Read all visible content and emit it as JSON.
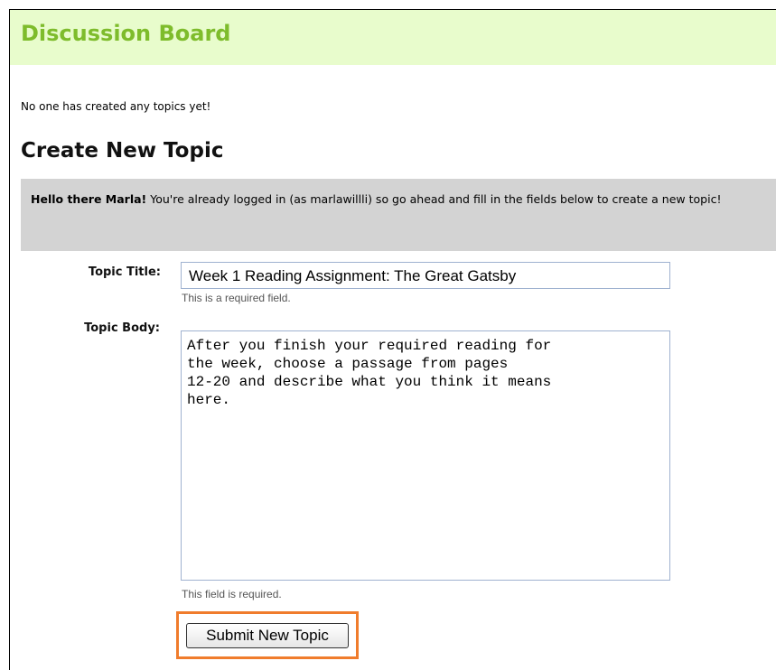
{
  "header": {
    "title": "Discussion Board"
  },
  "empty_message": "No one has created any topics yet!",
  "section_title": "Create New Topic",
  "notice": {
    "greeting": "Hello there Marla!",
    "message": " You're already logged in (as marlawillli) so go ahead and fill in the fields below to create a new topic!"
  },
  "form": {
    "topic_title_label": "Topic Title:",
    "topic_title_value": "Week 1 Reading Assignment: The Great Gatsby",
    "topic_title_hint": "This is a required field.",
    "topic_body_label": "Topic Body:",
    "topic_body_value": "After you finish your required reading for\nthe week, choose a passage from pages\n12-20 and describe what you think it means\nhere.",
    "topic_body_hint": "This field is required.",
    "submit_label": "Submit New Topic"
  },
  "colors": {
    "header_background": "#e8fccc",
    "header_text": "#7ebc2c",
    "notice_background": "#d3d3d3",
    "highlight": "#f07c2c"
  }
}
